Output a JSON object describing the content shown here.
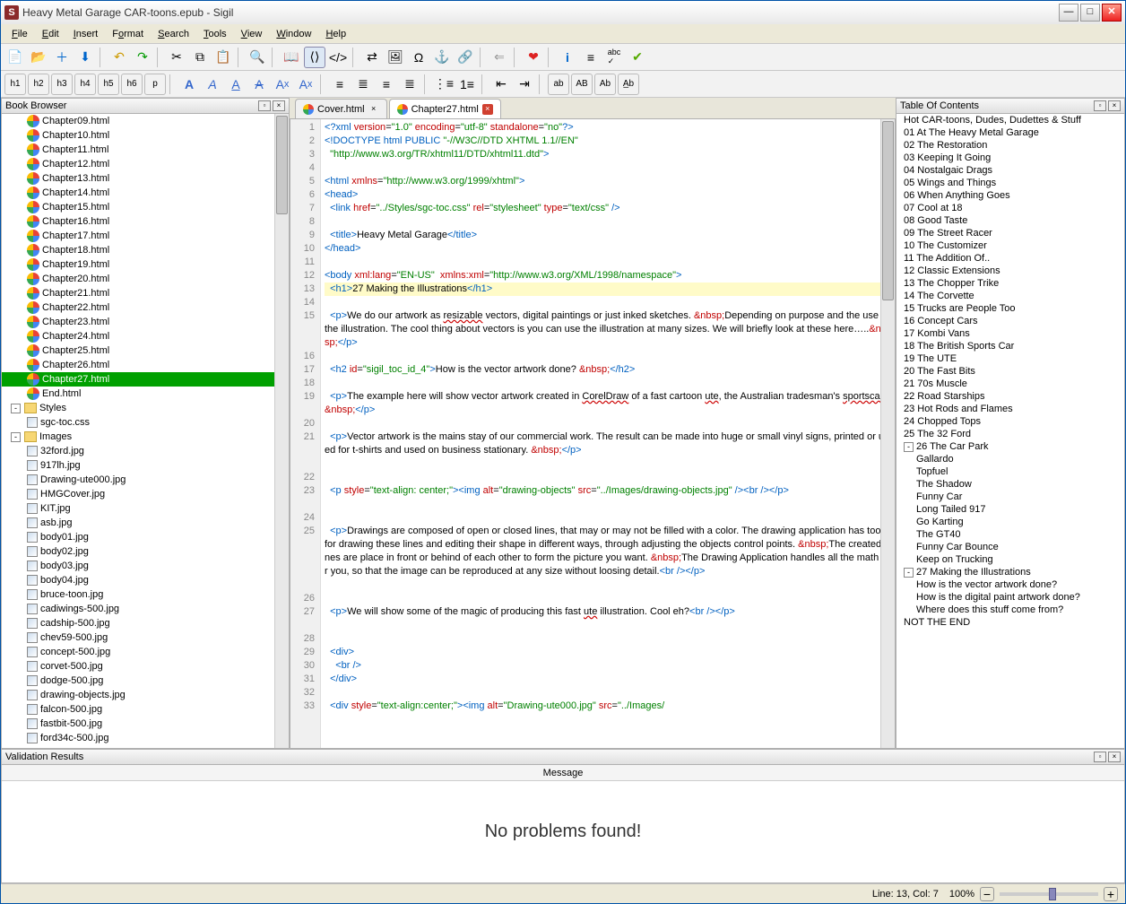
{
  "app": {
    "title": "Heavy Metal Garage CAR-toons.epub - Sigil",
    "icon_letter": "S"
  },
  "menu": [
    "File",
    "Edit",
    "Insert",
    "Format",
    "Search",
    "Tools",
    "View",
    "Window",
    "Help"
  ],
  "panels": {
    "browser_title": "Book Browser",
    "toc_title": "Table Of Contents",
    "validation_title": "Validation Results",
    "validation_hdr": "Message",
    "validation_msg": "No problems found!"
  },
  "browser": {
    "chapters": [
      "Chapter09.html",
      "Chapter10.html",
      "Chapter11.html",
      "Chapter12.html",
      "Chapter13.html",
      "Chapter14.html",
      "Chapter15.html",
      "Chapter16.html",
      "Chapter17.html",
      "Chapter18.html",
      "Chapter19.html",
      "Chapter20.html",
      "Chapter21.html",
      "Chapter22.html",
      "Chapter23.html",
      "Chapter24.html",
      "Chapter25.html",
      "Chapter26.html",
      "Chapter27.html",
      "End.html"
    ],
    "selected": "Chapter27.html",
    "styles_label": "Styles",
    "styles": [
      "sgc-toc.css"
    ],
    "images_label": "Images",
    "images": [
      "32ford.jpg",
      "917lh.jpg",
      "Drawing-ute000.jpg",
      "HMGCover.jpg",
      "KIT.jpg",
      "asb.jpg",
      "body01.jpg",
      "body02.jpg",
      "body03.jpg",
      "body04.jpg",
      "bruce-toon.jpg",
      "cadiwings-500.jpg",
      "cadship-500.jpg",
      "chev59-500.jpg",
      "concept-500.jpg",
      "corvet-500.jpg",
      "dodge-500.jpg",
      "drawing-objects.jpg",
      "falcon-500.jpg",
      "fastbit-500.jpg",
      "ford34c-500.jpg"
    ]
  },
  "tabs": [
    {
      "label": "Cover.html",
      "active": false
    },
    {
      "label": "Chapter27.html",
      "active": true
    }
  ],
  "toc": [
    {
      "t": "Hot CAR-toons, Dudes, Dudettes & Stuff",
      "l": 0
    },
    {
      "t": "01 At The Heavy Metal Garage",
      "l": 0
    },
    {
      "t": "02 The Restoration",
      "l": 0
    },
    {
      "t": "03 Keeping It Going",
      "l": 0
    },
    {
      "t": "04 Nostalgaic Drags",
      "l": 0
    },
    {
      "t": "05 Wings and Things",
      "l": 0
    },
    {
      "t": "06 When Anything Goes",
      "l": 0
    },
    {
      "t": "07 Cool at 18",
      "l": 0
    },
    {
      "t": "08 Good Taste",
      "l": 0
    },
    {
      "t": "09 The Street Racer",
      "l": 0
    },
    {
      "t": "10 The Customizer",
      "l": 0
    },
    {
      "t": "11 The Addition Of..",
      "l": 0
    },
    {
      "t": "12 Classic Extensions",
      "l": 0
    },
    {
      "t": "13 The Chopper Trike",
      "l": 0
    },
    {
      "t": "14 The Corvette",
      "l": 0
    },
    {
      "t": "15 Trucks are People Too",
      "l": 0
    },
    {
      "t": "16 Concept Cars",
      "l": 0
    },
    {
      "t": "17 Kombi Vans",
      "l": 0
    },
    {
      "t": "18 The British Sports Car",
      "l": 0
    },
    {
      "t": "19 The UTE",
      "l": 0
    },
    {
      "t": "20 The Fast Bits",
      "l": 0
    },
    {
      "t": "21 70s Muscle",
      "l": 0
    },
    {
      "t": "22 Road Starships",
      "l": 0
    },
    {
      "t": "23 Hot Rods and Flames",
      "l": 0
    },
    {
      "t": "24 Chopped Tops",
      "l": 0
    },
    {
      "t": "25 The 32 Ford",
      "l": 0
    },
    {
      "t": "26 The Car Park",
      "l": 0,
      "exp": "-"
    },
    {
      "t": "Gallardo",
      "l": 1
    },
    {
      "t": "Topfuel",
      "l": 1
    },
    {
      "t": "The Shadow",
      "l": 1
    },
    {
      "t": "Funny Car",
      "l": 1
    },
    {
      "t": "Long Tailed 917",
      "l": 1
    },
    {
      "t": "Go Karting",
      "l": 1
    },
    {
      "t": "The GT40",
      "l": 1
    },
    {
      "t": "Funny Car Bounce",
      "l": 1
    },
    {
      "t": "Keep on Trucking",
      "l": 1
    },
    {
      "t": "27 Making the Illustrations",
      "l": 0,
      "exp": "-"
    },
    {
      "t": "How is the vector artwork done?",
      "l": 1
    },
    {
      "t": "How is the digital paint artwork done?",
      "l": 1
    },
    {
      "t": "Where does this stuff come from?",
      "l": 1
    },
    {
      "t": "NOT THE END",
      "l": 0
    }
  ],
  "status": {
    "pos": "Line: 13, Col: 7",
    "zoom": "100%"
  }
}
